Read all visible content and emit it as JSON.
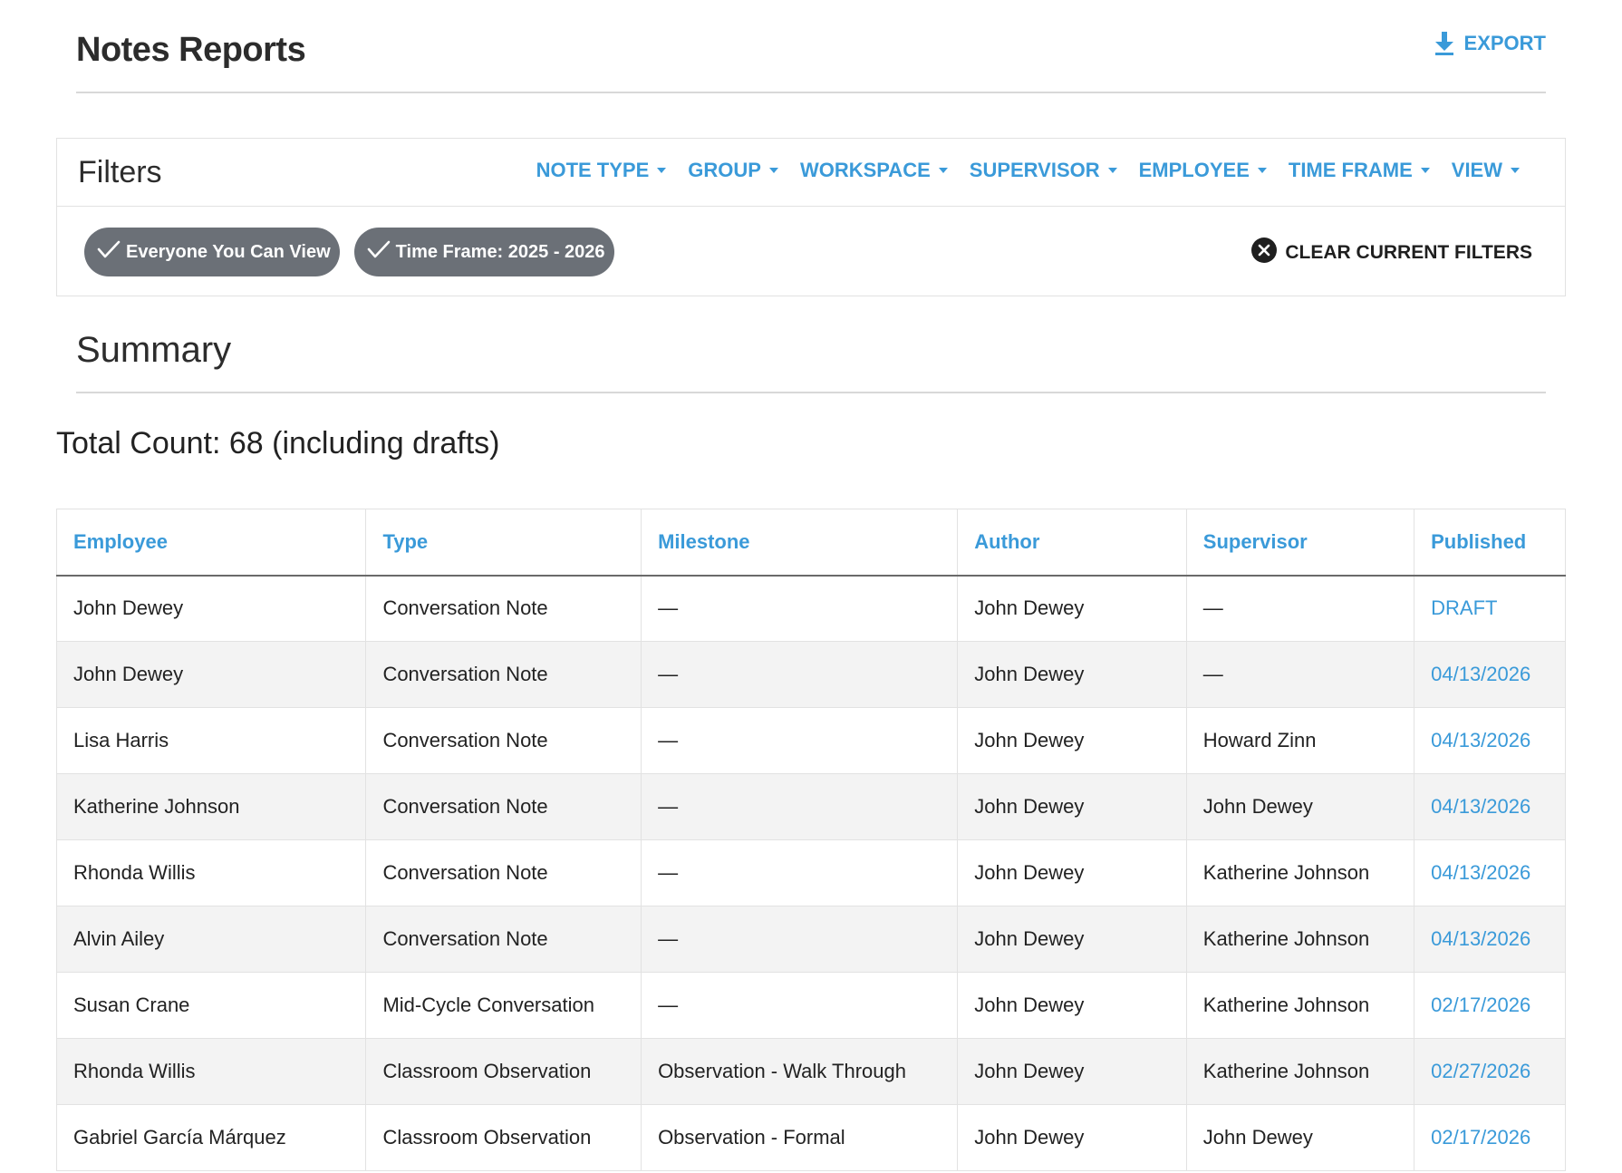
{
  "header": {
    "title": "Notes Reports",
    "export_label": "EXPORT"
  },
  "filters": {
    "title": "Filters",
    "menus": [
      "NOTE TYPE",
      "GROUP",
      "WORKSPACE",
      "SUPERVISOR",
      "EMPLOYEE",
      "TIME FRAME",
      "VIEW"
    ],
    "chips": [
      "Everyone You Can View",
      "Time Frame: 2025 - 2026"
    ],
    "clear_label": "CLEAR CURRENT FILTERS"
  },
  "summary": {
    "title": "Summary",
    "total_count": "Total Count: 68 (including drafts)"
  },
  "table": {
    "columns": [
      "Employee",
      "Type",
      "Milestone",
      "Author",
      "Supervisor",
      "Published"
    ],
    "rows": [
      [
        "John Dewey",
        "Conversation Note",
        "—",
        "John Dewey",
        "—",
        "DRAFT"
      ],
      [
        "John Dewey",
        "Conversation Note",
        "—",
        "John Dewey",
        "—",
        "04/13/2026"
      ],
      [
        "Lisa Harris",
        "Conversation Note",
        "—",
        "John Dewey",
        "Howard Zinn",
        "04/13/2026"
      ],
      [
        "Katherine Johnson",
        "Conversation Note",
        "—",
        "John Dewey",
        "John Dewey",
        "04/13/2026"
      ],
      [
        "Rhonda Willis",
        "Conversation Note",
        "—",
        "John Dewey",
        "Katherine Johnson",
        "04/13/2026"
      ],
      [
        "Alvin Ailey",
        "Conversation Note",
        "—",
        "John Dewey",
        "Katherine Johnson",
        "04/13/2026"
      ],
      [
        "Susan Crane",
        "Mid-Cycle Conversation",
        "—",
        "John Dewey",
        "Katherine Johnson",
        "02/17/2026"
      ],
      [
        "Rhonda Willis",
        "Classroom Observation",
        "Observation - Walk Through",
        "John Dewey",
        "Katherine Johnson",
        "02/27/2026"
      ],
      [
        "Gabriel García Márquez",
        "Classroom Observation",
        "Observation - Formal",
        "John Dewey",
        "John Dewey",
        "02/17/2026"
      ]
    ]
  },
  "colors": {
    "accent": "#3a9ad9",
    "chip_bg": "#6b7077",
    "row_alt": "#f3f3f3"
  },
  "icons": {
    "export": "download-icon",
    "chip_check": "checkmark-icon",
    "clear": "close-circle-icon",
    "menu_caret": "caret-down-icon"
  }
}
